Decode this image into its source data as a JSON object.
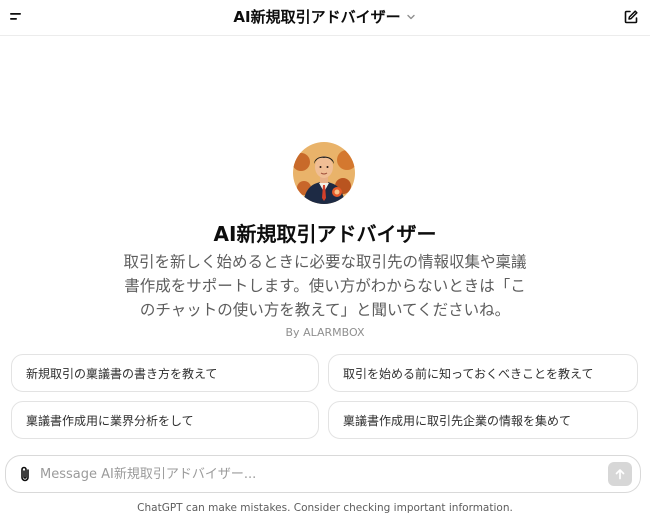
{
  "header": {
    "title": "AI新規取引アドバイザー",
    "menu_icon": "menu-icon",
    "dropdown_icon": "chevron-down-icon",
    "new_chat_icon": "edit-icon"
  },
  "gpt": {
    "name": "AI新規取引アドバイザー",
    "description": "取引を新しく始めるときに必要な取引先の情報収集や稟議書作成をサポートします。使い方がわからないときは「このチャットの使い方を教えて」と聞いてくださいね。",
    "author": "By ALARMBOX"
  },
  "suggestions": [
    {
      "label": "新規取引の稟議書の書き方を教えて"
    },
    {
      "label": "取引を始める前に知っておくべきことを教えて"
    },
    {
      "label": "稟議書作成用に業界分析をして"
    },
    {
      "label": "稟議書作成用に取引先企業の情報を集めて"
    }
  ],
  "composer": {
    "placeholder": "Message AI新規取引アドバイザー...",
    "value": "",
    "attach_icon": "paperclip-icon",
    "send_icon": "arrow-up-icon"
  },
  "footer": {
    "disclaimer": "ChatGPT can make mistakes. Consider checking important information."
  },
  "colors": {
    "text": "#0d0d0d",
    "muted": "#5d5d5d",
    "border": "#e3e3e3",
    "send_disabled": "#d7d7d7"
  }
}
